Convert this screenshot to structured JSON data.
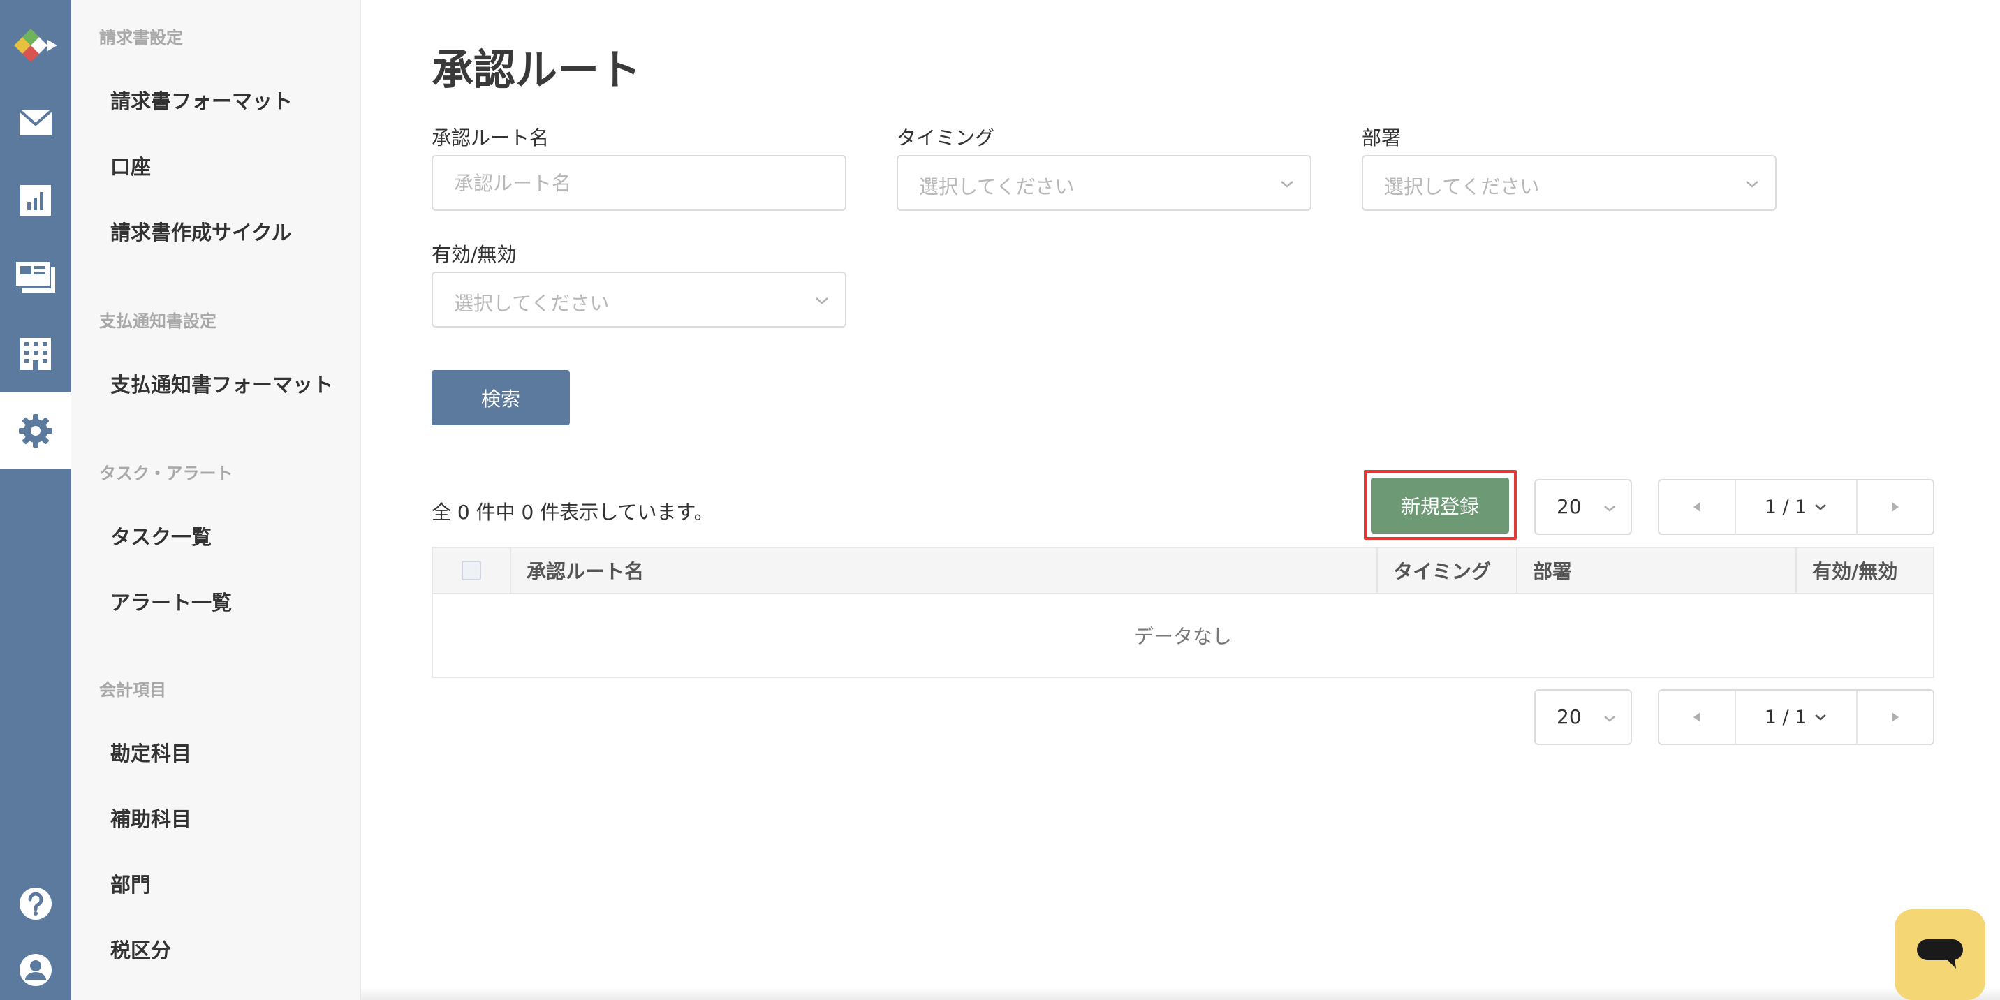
{
  "rail": {
    "items": [
      {
        "icon": "app-logo-icon"
      },
      {
        "icon": "mail-icon"
      },
      {
        "icon": "bar-chart-icon"
      },
      {
        "icon": "payment-document-icon"
      },
      {
        "icon": "building-icon"
      },
      {
        "icon": "gear-icon",
        "active": true
      },
      {
        "icon": "help-icon"
      },
      {
        "icon": "user-account-icon"
      }
    ],
    "colors": {
      "background": "#5b7a9e",
      "active_background": "#ffffff"
    }
  },
  "subnav": {
    "sections": [
      {
        "title": "請求書設定",
        "items": [
          "請求書フォーマット",
          "口座",
          "請求書作成サイクル"
        ]
      },
      {
        "title": "支払通知書設定",
        "items": [
          "支払通知書フォーマット"
        ]
      },
      {
        "title": "タスク・アラート",
        "items": [
          "タスク一覧",
          "アラート一覧"
        ]
      },
      {
        "title": "会計項目",
        "items": [
          "勘定科目",
          "補助科目",
          "部門",
          "税区分"
        ]
      }
    ]
  },
  "page": {
    "title": "承認ルート"
  },
  "filters": {
    "route_name": {
      "label": "承認ルート名",
      "placeholder": "承認ルート名"
    },
    "timing": {
      "label": "タイミング",
      "placeholder": "選択してください"
    },
    "department": {
      "label": "部署",
      "placeholder": "選択してください"
    },
    "active": {
      "label": "有効/無効",
      "placeholder": "選択してください"
    },
    "search_label": "検索"
  },
  "results": {
    "count_text": "全 0 件中 0 件表示しています。",
    "new_label": "新規登録",
    "page_size": "20",
    "page_indicator": "1 / 1"
  },
  "table": {
    "columns": [
      "承認ルート名",
      "タイミング",
      "部署",
      "有効/無効"
    ],
    "empty_text": "データなし"
  },
  "colors": {
    "primary": "#5b7a9e",
    "new_button": "#6d9a75",
    "highlight": "#e53935",
    "chat_widget": "#f4d675"
  }
}
